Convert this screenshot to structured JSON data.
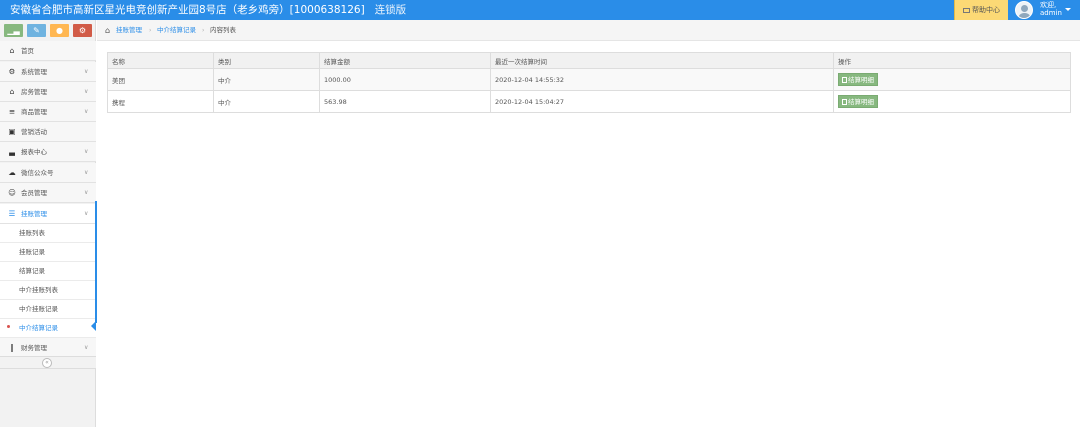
{
  "header": {
    "title": "安徽省合肥市高新区星光电竞创新产业园8号店（老乡鸡旁）[1000638126]",
    "edition": "连锁版",
    "help_label": "帮助中心",
    "welcome": "欢迎,",
    "username": "admin"
  },
  "sidebar": {
    "shortcuts": [
      {
        "icon": "chart-icon",
        "color": "#87b87f"
      },
      {
        "icon": "pencil-icon",
        "color": "#6fb3e0"
      },
      {
        "icon": "users-icon",
        "color": "#ffb752"
      },
      {
        "icon": "settings-icon",
        "color": "#d15b47"
      }
    ],
    "items": [
      {
        "label": "首页",
        "icon": "home-icon"
      },
      {
        "label": "系统管理",
        "icon": "gear-icon"
      },
      {
        "label": "房务管理",
        "icon": "bank-icon"
      },
      {
        "label": "商品管理",
        "icon": "database-icon"
      },
      {
        "label": "营销活动",
        "icon": "gift-icon"
      },
      {
        "label": "报表中心",
        "icon": "bar-chart-icon"
      },
      {
        "label": "微信公众号",
        "icon": "cloud-icon"
      },
      {
        "label": "会员管理",
        "icon": "group-icon"
      },
      {
        "label": "挂账管理",
        "icon": "list-icon"
      },
      {
        "label": "财务管理",
        "icon": "cutlery-icon"
      }
    ],
    "sub_items": [
      "挂账列表",
      "挂账记录",
      "结算记录",
      "中介挂账列表",
      "中介挂账记录",
      "中介结算记录"
    ]
  },
  "breadcrumb": {
    "level1": "挂账管理",
    "level2": "中介结算记录",
    "level3": "内容列表"
  },
  "table": {
    "headers": [
      "名称",
      "类别",
      "结算金额",
      "最近一次结算时间",
      "操作"
    ],
    "rows": [
      {
        "name": "美团",
        "type": "中介",
        "amount": "1000.00",
        "time": "2020-12-04 14:55:32",
        "action": "结算明细"
      },
      {
        "name": "携程",
        "type": "中介",
        "amount": "563.98",
        "time": "2020-12-04 15:04:27",
        "action": "结算明细"
      }
    ]
  }
}
